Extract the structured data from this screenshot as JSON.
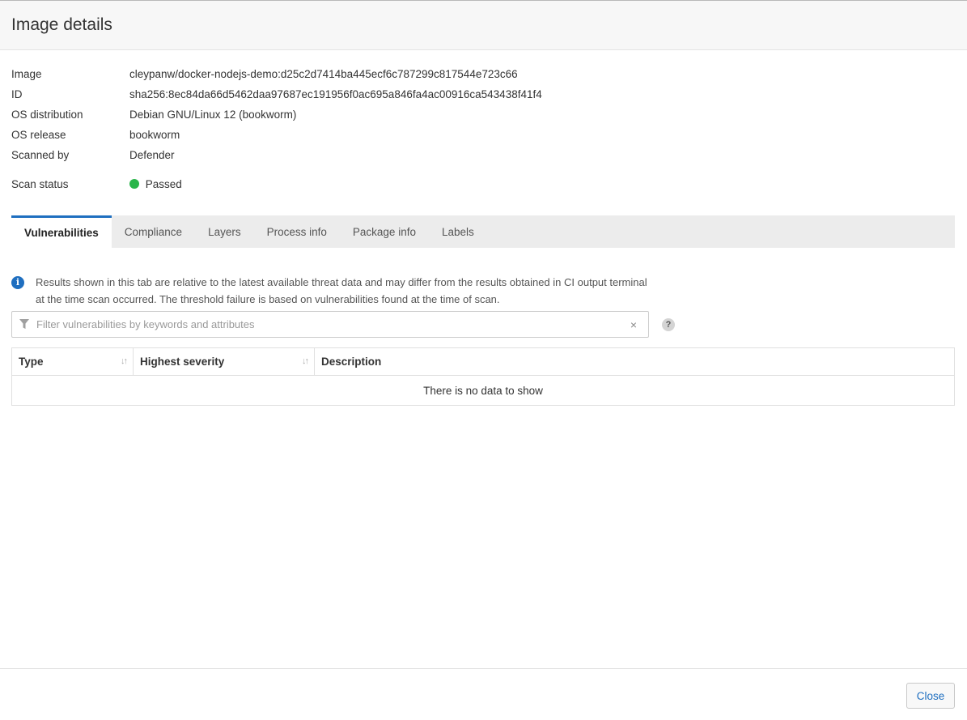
{
  "header": {
    "title": "Image details"
  },
  "details": [
    {
      "label": "Image",
      "value": "cleypanw/docker-nodejs-demo:d25c2d7414ba445ecf6c787299c817544e723c66"
    },
    {
      "label": "ID",
      "value": "sha256:8ec84da66d5462daa97687ec191956f0ac695a846fa4ac00916ca543438f41f4"
    },
    {
      "label": "OS distribution",
      "value": "Debian GNU/Linux 12 (bookworm)"
    },
    {
      "label": "OS release",
      "value": "bookworm"
    },
    {
      "label": "Scanned by",
      "value": "Defender"
    }
  ],
  "scan_status": {
    "label": "Scan status",
    "value": "Passed",
    "color": "#2ab54a"
  },
  "tabs": [
    {
      "label": "Vulnerabilities",
      "active": true
    },
    {
      "label": "Compliance"
    },
    {
      "label": "Layers"
    },
    {
      "label": "Process info"
    },
    {
      "label": "Package info"
    },
    {
      "label": "Labels"
    }
  ],
  "notice": {
    "icon": "info-icon",
    "line1": "Results shown in this tab are relative to the latest available threat data and may differ from the results obtained in CI output terminal",
    "line2": "at the time scan occurred. The threshold failure is based on vulnerabilities found at the time of scan."
  },
  "filter": {
    "placeholder": "Filter vulnerabilities by keywords and attributes",
    "value": "",
    "clear": "×",
    "help": "?"
  },
  "table": {
    "columns": [
      "Type",
      "Highest severity",
      "Description"
    ],
    "empty_text": "There is no data to show",
    "sort_glyph": "↓↑"
  },
  "footer": {
    "close_label": "Close"
  },
  "colors": {
    "accent": "#1f6fc0",
    "success": "#2ab54a"
  }
}
